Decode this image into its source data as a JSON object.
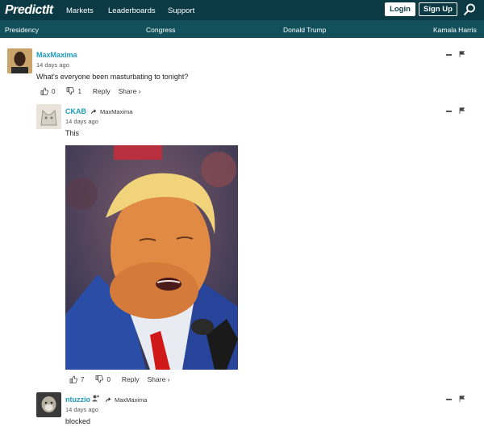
{
  "header": {
    "logo": "PredictIt",
    "nav": [
      "Markets",
      "Leaderboards",
      "Support"
    ],
    "login_label": "Login",
    "signup_label": "Sign Up"
  },
  "subnav": [
    "Presidency",
    "Congress",
    "Donald Trump",
    "Kamala Harris"
  ],
  "comments": [
    {
      "user": "MaxMaxima",
      "time": "14 days ago",
      "text": "What's everyone been masturbating to tonight?",
      "likes": "0",
      "dislikes": "1",
      "reply_label": "Reply",
      "share_label": "Share ›"
    },
    {
      "user": "CKAB",
      "reply_to": "MaxMaxima",
      "time": "14 days ago",
      "text": "This",
      "likes": "7",
      "dislikes": "0",
      "reply_label": "Reply",
      "share_label": "Share ›"
    },
    {
      "user": "ntuzzio",
      "reply_to": "MaxMaxima",
      "time": "14 days ago",
      "text": "blocked"
    }
  ],
  "colors": {
    "header_bg": "#0b3a44",
    "subnav_bg": "#12505b",
    "username": "#1d9bbf"
  },
  "icons": [
    "search-icon",
    "thumbs-up-icon",
    "thumbs-down-icon",
    "reply-arrow-icon",
    "flag-icon",
    "collapse-icon",
    "follow-user-icon"
  ]
}
